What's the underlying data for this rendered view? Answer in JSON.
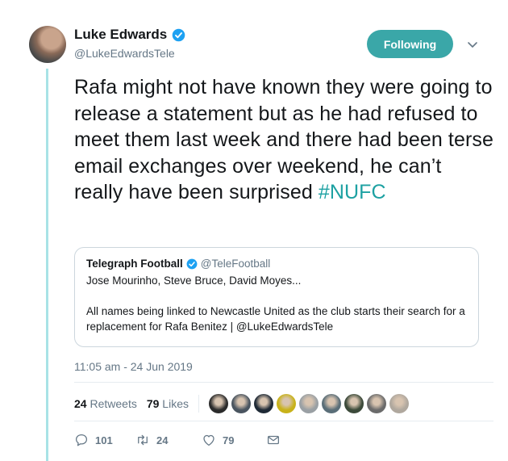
{
  "author": {
    "display_name": "Luke Edwards",
    "handle": "@LukeEdwardsTele",
    "verified": true
  },
  "follow_button": {
    "label": "Following",
    "color": "#3aa7a8"
  },
  "tweet": {
    "text": "Rafa might not have known they were going to release a statement but as he had refused to meet them last week and there had been terse email exchanges over weekend, he can’t really have been surprised ",
    "hashtag": "#NUFC"
  },
  "quote": {
    "display_name": "Telegraph Football",
    "handle": "@TeleFootball",
    "verified": true,
    "line1": "Jose Mourinho, Steve Bruce, David Moyes...",
    "line2": "All names being linked to Newcastle United as the club starts their search for a replacement for Rafa Benitez | @LukeEdwardsTele"
  },
  "timestamp": "11:05 am - 24 Jun 2019",
  "stats": {
    "retweets_count": "24",
    "retweets_label": "Retweets",
    "likes_count": "79",
    "likes_label": "Likes"
  },
  "liker_avatars": [
    {
      "color": "#2b2b2b"
    },
    {
      "color": "#4a5560"
    },
    {
      "color": "#1f2a36"
    },
    {
      "color": "#c8b21a"
    },
    {
      "color": "#9aa0a4"
    },
    {
      "color": "#5a6e78"
    },
    {
      "color": "#3c4a3a"
    },
    {
      "color": "#6b6b6b"
    },
    {
      "color": "#b0a89e"
    }
  ],
  "actions": {
    "replies": "101",
    "retweets": "24",
    "likes": "79"
  },
  "colors": {
    "accent": "#1da1a2",
    "verified": "#1da1f2",
    "thread_line": "#a8e3e6"
  }
}
